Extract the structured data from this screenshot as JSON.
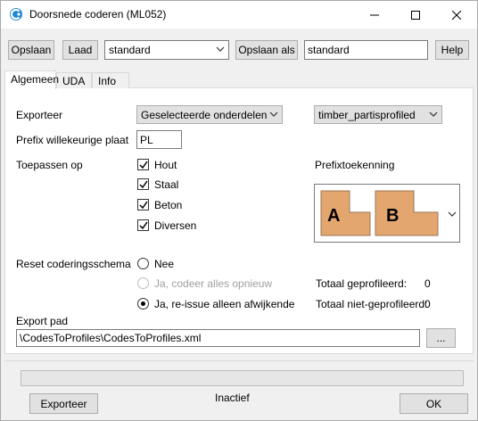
{
  "window": {
    "title": "Doorsnede coderen (ML052)",
    "minimize_icon": "minimize-icon",
    "maximize_icon": "maximize-icon",
    "close_icon": "close-icon"
  },
  "toolbar": {
    "save_label": "Opslaan",
    "load_label": "Laad",
    "preset_value": "standard",
    "save_as_label": "Opslaan als",
    "save_as_value": "standard",
    "help_label": "Help"
  },
  "tabs": [
    {
      "label": "Algemeen",
      "active": true
    },
    {
      "label": "UDA",
      "active": false
    },
    {
      "label": "Info",
      "active": false
    }
  ],
  "general": {
    "export_label": "Exporteer",
    "export_value": "Geselecteerde onderdelen",
    "profile_value": "timber_partisprofiled",
    "prefix_label": "Prefix willekeurige plaat",
    "prefix_value": "PL",
    "apply_label": "Toepassen op",
    "apply_options": [
      {
        "label": "Hout",
        "checked": true
      },
      {
        "label": "Staal",
        "checked": true
      },
      {
        "label": "Beton",
        "checked": true
      },
      {
        "label": "Diversen",
        "checked": true
      }
    ],
    "prefix_assign_label": "Prefixtoekenning",
    "prefix_tiles": [
      "A",
      "B"
    ],
    "tile_color": "#e4a66f",
    "reset_label": "Reset coderingsschema",
    "reset_options": [
      {
        "label": "Nee",
        "selected": false,
        "disabled": false
      },
      {
        "label": "Ja, codeer alles opnieuw",
        "selected": false,
        "disabled": true
      },
      {
        "label": "Ja, re-issue alleen afwijkende",
        "selected": true,
        "disabled": false
      }
    ],
    "total_profiled_label": "Totaal geprofileerd:",
    "total_profiled_value": "0",
    "total_not_profiled_label": "Totaal niet-geprofileerd:",
    "total_not_profiled_value": "0",
    "export_path_label": "Export pad",
    "export_path_value": "\\CodesToProfiles\\CodesToProfiles.xml",
    "browse_label": "..."
  },
  "footer": {
    "export_button": "Exporteer",
    "status": "Inactief",
    "ok_button": "OK",
    "progress": 0
  }
}
